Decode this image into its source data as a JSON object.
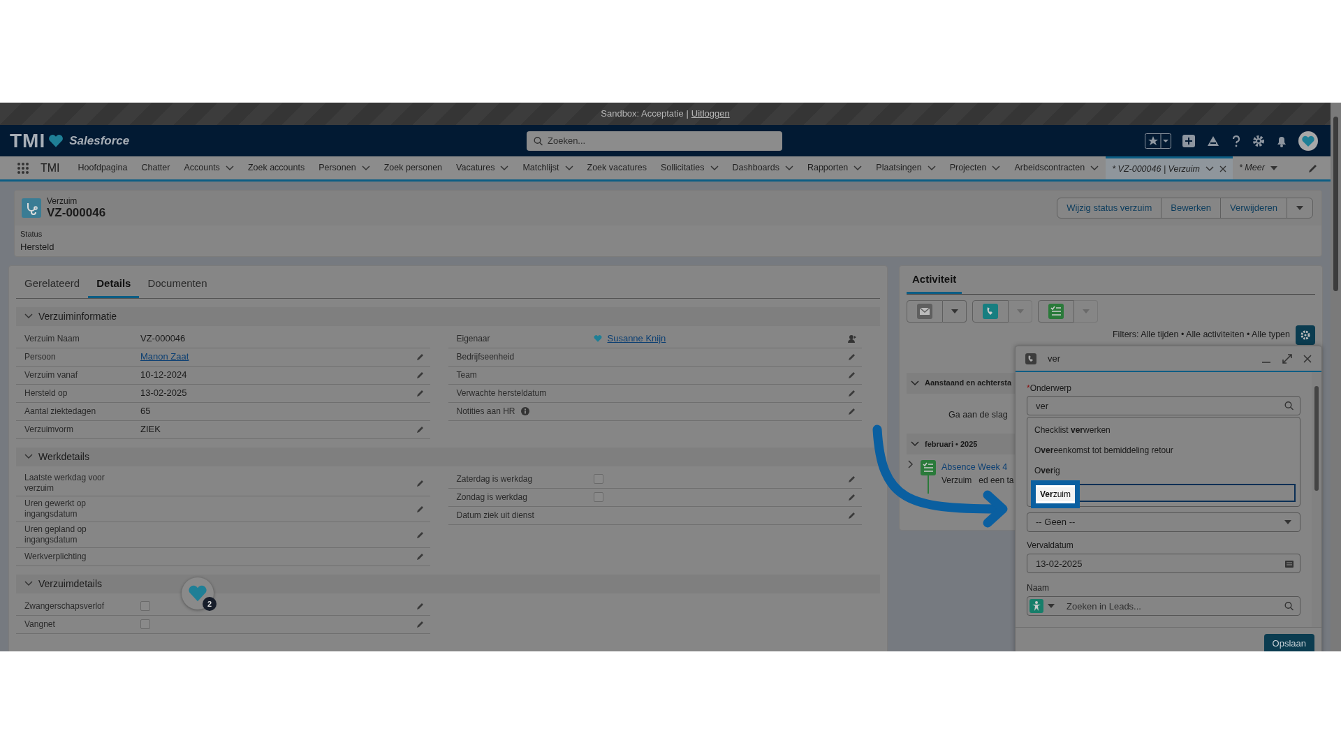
{
  "sandbox_bar": {
    "text": "Sandbox: Acceptatie |",
    "link": "Uitloggen"
  },
  "header": {
    "logo": "TMI",
    "brand": "Salesforce",
    "search": {
      "placeholder": "Zoeken..."
    }
  },
  "nav": {
    "app": "TMI",
    "items": [
      {
        "label": "Hoofdpagina",
        "dropdown": false
      },
      {
        "label": "Chatter",
        "dropdown": false
      },
      {
        "label": "Accounts",
        "dropdown": true
      },
      {
        "label": "Zoek accounts",
        "dropdown": false
      },
      {
        "label": "Personen",
        "dropdown": true
      },
      {
        "label": "Zoek personen",
        "dropdown": false
      },
      {
        "label": "Vacatures",
        "dropdown": true
      },
      {
        "label": "Matchlijst",
        "dropdown": true
      },
      {
        "label": "Zoek vacatures",
        "dropdown": false
      },
      {
        "label": "Sollicitaties",
        "dropdown": true
      },
      {
        "label": "Dashboards",
        "dropdown": true
      },
      {
        "label": "Rapporten",
        "dropdown": true
      },
      {
        "label": "Plaatsingen",
        "dropdown": true
      },
      {
        "label": "Projecten",
        "dropdown": true
      },
      {
        "label": "Arbeidscontracten",
        "dropdown": true
      }
    ],
    "tabs": [
      {
        "label": "* VZ-000046 | Verzuim",
        "selected": true,
        "closable": true
      },
      {
        "label": "* Meer",
        "selected": false,
        "closable": false
      }
    ]
  },
  "record": {
    "object": "Verzuim",
    "name": "VZ-000046",
    "actions": [
      "Wijzig status verzuim",
      "Bewerken",
      "Verwijderen"
    ],
    "status_label": "Status",
    "status_value": "Hersteld"
  },
  "detail_tabs": [
    {
      "label": "Gerelateerd",
      "selected": false
    },
    {
      "label": "Details",
      "selected": true
    },
    {
      "label": "Documenten",
      "selected": false
    }
  ],
  "sections": [
    {
      "title": "Verzuiminformatie",
      "expanded": true,
      "left": [
        {
          "label": "Verzuim Naam",
          "kind": "text",
          "value": "VZ-000046",
          "editable": false
        },
        {
          "label": "Persoon",
          "kind": "link",
          "value": "Manon Zaat",
          "editable": true
        },
        {
          "label": "Verzuim vanaf",
          "kind": "text",
          "value": "10-12-2024",
          "editable": true
        },
        {
          "label": "Hersteld op",
          "kind": "text",
          "value": "13-02-2025",
          "editable": true
        },
        {
          "label": "Aantal ziektedagen",
          "kind": "text",
          "value": "65",
          "editable": false
        },
        {
          "label": "Verzuimvorm",
          "kind": "text",
          "value": "ZIEK",
          "editable": true
        }
      ],
      "right": [
        {
          "label": "Eigenaar",
          "kind": "user",
          "value": "Susanne Knijn",
          "editable": false
        },
        {
          "label": "Bedrijfseenheid",
          "kind": "text",
          "editable": true
        },
        {
          "label": "Team",
          "kind": "text",
          "editable": true
        },
        {
          "label": "Verwachte hersteldatum",
          "kind": "text",
          "editable": true
        },
        {
          "label": "Notities aan HR",
          "kind": "text",
          "info": true,
          "editable": true
        }
      ]
    },
    {
      "title": "Werkdetails",
      "expanded": true,
      "left": [
        {
          "label": "Laatste werkdag voor verzuim",
          "kind": "text",
          "editable": true
        },
        {
          "label": "Uren gewerkt op ingangsdatum",
          "kind": "text",
          "editable": true
        },
        {
          "label": "Uren gepland op ingangsdatum",
          "kind": "text",
          "editable": true
        },
        {
          "label": "Werkverplichting",
          "kind": "text",
          "editable": true
        }
      ],
      "right": [
        {
          "label": "Zaterdag is werkdag",
          "kind": "checkbox",
          "checked": false,
          "editable": true
        },
        {
          "label": "Zondag is werkdag",
          "kind": "checkbox",
          "checked": false,
          "editable": true
        },
        {
          "label": "Datum ziek uit dienst",
          "kind": "text",
          "editable": true
        }
      ]
    },
    {
      "title": "Verzuimdetails",
      "expanded": true,
      "left": [
        {
          "label": "Zwangerschapsverlof",
          "kind": "checkbox",
          "checked": false,
          "editable": true
        },
        {
          "label": "Vangnet",
          "kind": "checkbox",
          "checked": false,
          "editable": true
        }
      ]
    }
  ],
  "activity": {
    "tab": "Activiteit",
    "actions": [
      {
        "kind": "email",
        "dropdown_disabled": false
      },
      {
        "kind": "call",
        "dropdown_disabled": true
      },
      {
        "kind": "task",
        "dropdown_disabled": true
      }
    ],
    "filters": "Filters: Alle tijden • Alle activiteiten • Alle typen",
    "groups": [
      {
        "title": "Aanstaand en achtersta",
        "expanded": true,
        "empty_text": "Ga aan de slag"
      },
      {
        "title": "februari • 2025",
        "expanded": true,
        "items": [
          {
            "kind": "task",
            "title": "Absence Week 4",
            "subtitle_parts": [
              "Verzuim",
              "ed een ta"
            ],
            "expanded": false
          }
        ]
      }
    ]
  },
  "task_window": {
    "title": "ver",
    "subject": {
      "label": "Onderwerp",
      "required_marker": "*",
      "value": "ver",
      "options": [
        {
          "label": "Checklist **ver**werken",
          "selected": false
        },
        {
          "label": "O**ver**eenkomst tot bemiddeling retour",
          "selected": false
        },
        {
          "label": "O**ver**ig",
          "selected": false
        },
        {
          "label": "**Ver**zuim",
          "selected": true
        }
      ]
    },
    "select": {
      "value": "-- Geen --"
    },
    "due": {
      "label": "Vervaldatum",
      "value": "13-02-2025"
    },
    "name": {
      "label": "Naam",
      "placeholder": "Zoeken in Leads..."
    },
    "save": "Opslaan"
  },
  "helper": {
    "badge": "2"
  }
}
